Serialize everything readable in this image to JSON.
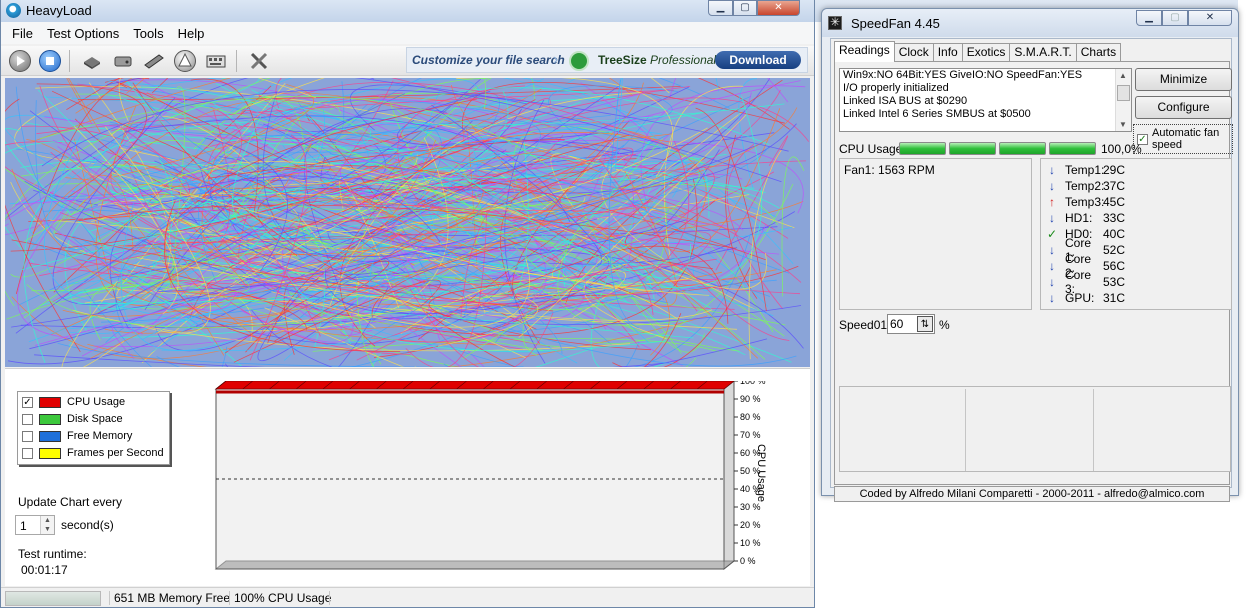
{
  "heavyload": {
    "title": "HeavyLoad",
    "menu": [
      "File",
      "Test Options",
      "Tools",
      "Help"
    ],
    "ad": {
      "text": "Customize your file search",
      "product_brand": "TreeSize",
      "product_edition": "Professional",
      "button": "Download"
    },
    "legend": [
      {
        "label": "CPU Usage",
        "checked": true,
        "color": "#e00000"
      },
      {
        "label": "Disk Space",
        "checked": false,
        "color": "#3cc83c"
      },
      {
        "label": "Free Memory",
        "checked": false,
        "color": "#1e6fd9"
      },
      {
        "label": "Frames per Second",
        "checked": false,
        "color": "#ffff00"
      }
    ],
    "update_label": "Update Chart every",
    "update_value": "1",
    "update_unit": "second(s)",
    "runtime_label": "Test runtime:",
    "runtime_value": "00:01:17",
    "status": {
      "memory": "651 MB Memory Free",
      "cpu": "100% CPU Usage"
    },
    "accent": "#2b4b7a"
  },
  "chart_data": {
    "type": "area",
    "title": "",
    "ylabel": "CPU Usage",
    "ylim": [
      0,
      100
    ],
    "yticks": [
      "100 %",
      "90 %",
      "80 %",
      "70 %",
      "60 %",
      "50 %",
      "40 %",
      "30 %",
      "20 %",
      "10 %",
      "0 %"
    ],
    "series": [
      {
        "name": "CPU Usage",
        "values": [
          100,
          100,
          100,
          100,
          100,
          100,
          100,
          100,
          100,
          100,
          100,
          100,
          100,
          100,
          100,
          100,
          100,
          100,
          100,
          100
        ]
      }
    ],
    "color": "#e00000",
    "grid": "dashed line at 50%"
  },
  "speedfan": {
    "title": "SpeedFan 4.45",
    "tabs": [
      "Readings",
      "Clock",
      "Info",
      "Exotics",
      "S.M.A.R.T.",
      "Charts"
    ],
    "active_tab": "Readings",
    "log": [
      "Win9x:NO  64Bit:YES  GiveIO:NO  SpeedFan:YES",
      "I/O properly initialized",
      "Linked ISA BUS at $0290",
      "Linked Intel 6 Series SMBUS at $0500"
    ],
    "buttons": {
      "minimize": "Minimize",
      "configure": "Configure"
    },
    "auto_fan_label": "Automatic fan speed",
    "auto_fan_checked": true,
    "cpu_label": "CPU Usage",
    "cpu_value": "100,0%",
    "cpu_bars": 4,
    "fan": "Fan1: 1563 RPM",
    "temps": [
      {
        "name": "Temp1:",
        "value": "29C",
        "icon": "arrow-down"
      },
      {
        "name": "Temp2:",
        "value": "37C",
        "icon": "arrow-down"
      },
      {
        "name": "Temp3:",
        "value": "45C",
        "icon": "arrow-up"
      },
      {
        "name": "HD1:",
        "value": "33C",
        "icon": "arrow-down"
      },
      {
        "name": "HD0:",
        "value": "40C",
        "icon": "checkmark"
      },
      {
        "name": "Core 1:",
        "value": "52C",
        "icon": "arrow-down"
      },
      {
        "name": "Core 2:",
        "value": "56C",
        "icon": "arrow-down"
      },
      {
        "name": "Core 3:",
        "value": "53C",
        "icon": "arrow-down"
      },
      {
        "name": "GPU:",
        "value": "31C",
        "icon": "arrow-down"
      }
    ],
    "speed_label": "Speed01:",
    "speed_value": "60",
    "speed_unit": "%",
    "credit": "Coded by Alfredo Milani Comparetti - 2000-2011 - alfredo@almico.com"
  }
}
